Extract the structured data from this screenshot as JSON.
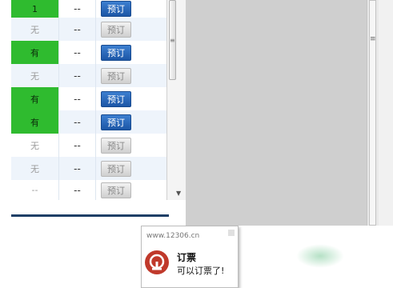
{
  "rows": [
    {
      "status": "1",
      "status_green": true,
      "dash": "--",
      "button": "预订",
      "enabled": true
    },
    {
      "status": "无",
      "status_green": false,
      "dash": "--",
      "button": "预订",
      "enabled": false
    },
    {
      "status": "有",
      "status_green": true,
      "dash": "--",
      "button": "预订",
      "enabled": true
    },
    {
      "status": "无",
      "status_green": false,
      "dash": "--",
      "button": "预订",
      "enabled": false
    },
    {
      "status": "有",
      "status_green": true,
      "dash": "--",
      "button": "预订",
      "enabled": true
    },
    {
      "status": "有",
      "status_green": true,
      "dash": "--",
      "button": "预订",
      "enabled": true
    },
    {
      "status": "无",
      "status_green": false,
      "dash": "--",
      "button": "预订",
      "enabled": false
    },
    {
      "status": "无",
      "status_green": false,
      "dash": "--",
      "button": "预订",
      "enabled": false
    },
    {
      "status": "--",
      "status_green": false,
      "dash": "--",
      "button": "预订",
      "enabled": false
    }
  ],
  "popup": {
    "url": "www.12306.cn",
    "title": "订票",
    "message": "可以订票了!"
  },
  "icons": {
    "app_logo": "railway-logo-icon",
    "scroll_down": "scroll-down-arrow-icon",
    "close": "close-icon"
  },
  "colors": {
    "available_green": "#2fbb2f",
    "book_button_blue": "#1c56a6",
    "logo_red": "#c0392b"
  }
}
